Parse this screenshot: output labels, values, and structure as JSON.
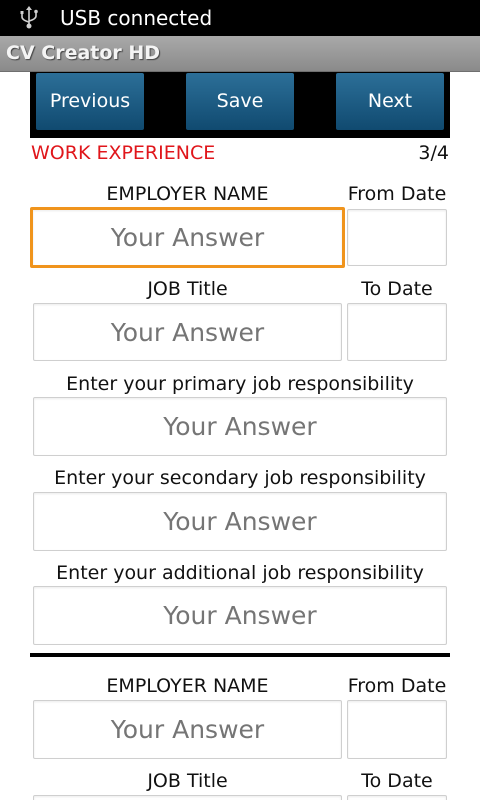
{
  "status_bar": {
    "text": "USB connected",
    "icon": "usb-icon"
  },
  "app": {
    "title": "CV Creator HD"
  },
  "nav": {
    "previous": "Previous",
    "save": "Save",
    "next": "Next"
  },
  "section": {
    "title": "WORK EXPERIENCE",
    "page": "3/4"
  },
  "form": {
    "placeholder": "Your Answer",
    "employer_label": "EMPLOYER NAME",
    "from_date_label": "From Date",
    "job_title_label": "JOB Title",
    "to_date_label": "To Date",
    "primary_label": "Enter your primary job responsibility",
    "secondary_label": "Enter your secondary job responsibility",
    "additional_label": "Enter your additional job responsibility"
  },
  "colors": {
    "section_title": "#e0161b",
    "button": "#1a5a82",
    "focus_border": "#f0941c"
  }
}
